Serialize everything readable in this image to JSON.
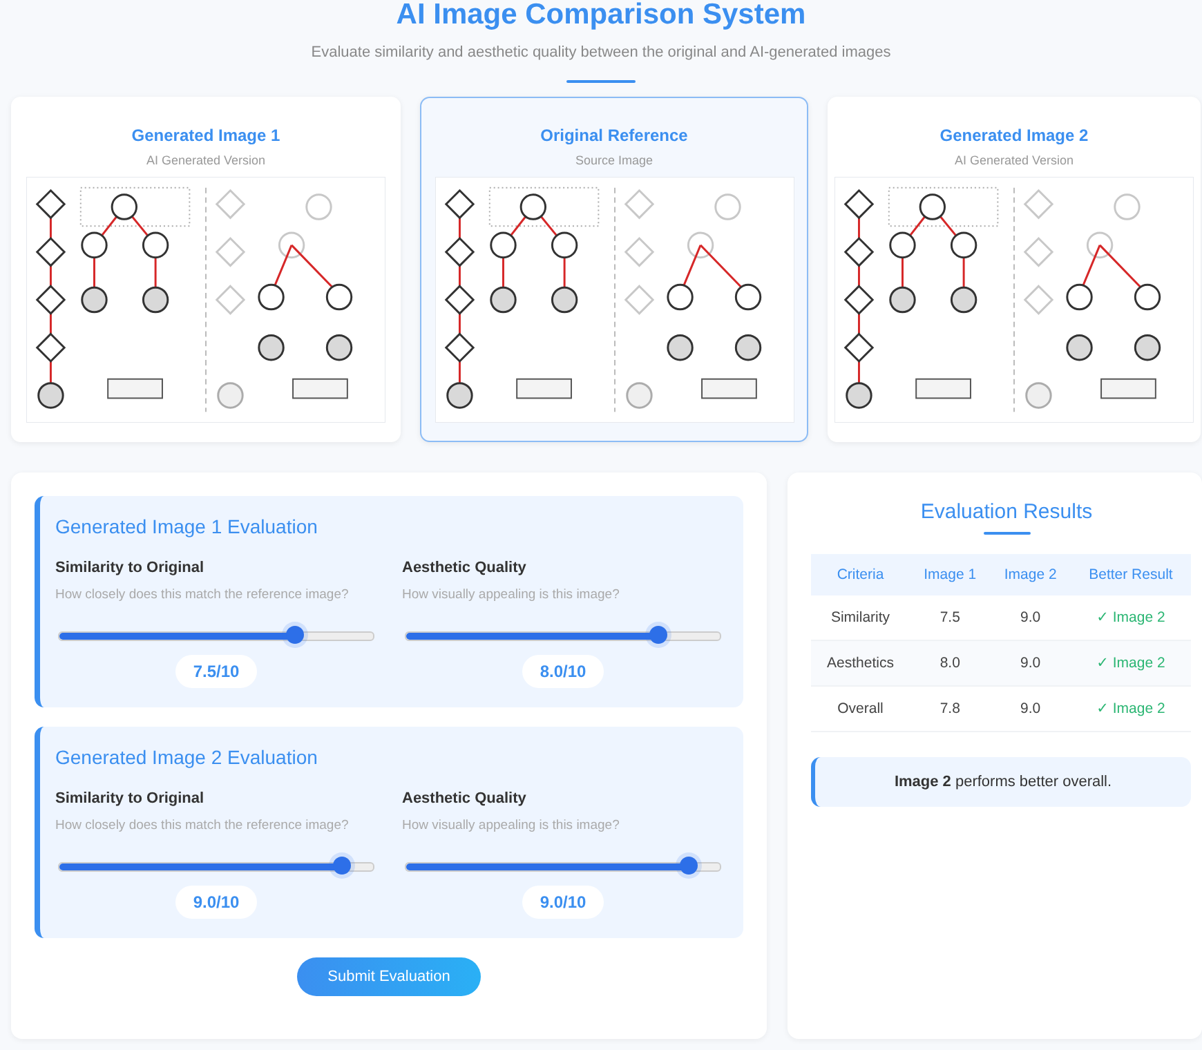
{
  "header": {
    "title": "AI Image Comparison System",
    "subtitle": "Evaluate similarity and aesthetic quality between the original and AI-generated images"
  },
  "images": [
    {
      "title": "Generated Image 1",
      "subtitle": "AI Generated Version",
      "selected": false,
      "kind": "picture"
    },
    {
      "title": "Original Reference",
      "subtitle": "Source Image",
      "selected": true,
      "kind": "picture"
    },
    {
      "title": "Generated Image 2",
      "subtitle": "AI Generated Version",
      "selected": false,
      "kind": "picture"
    }
  ],
  "evaluations": [
    {
      "title": "Generated Image 1 Evaluation",
      "criteria": [
        {
          "label": "Similarity to Original",
          "hint": "How closely does this match the reference image?",
          "level": 0.75,
          "reading": "7.5/10"
        },
        {
          "label": "Aesthetic Quality",
          "hint": "How visually appealing is this image?",
          "level": 0.8,
          "reading": "8.0/10"
        }
      ]
    },
    {
      "title": "Generated Image 2 Evaluation",
      "criteria": [
        {
          "label": "Similarity to Original",
          "hint": "How closely does this match the reference image?",
          "level": 0.9,
          "reading": "9.0/10"
        },
        {
          "label": "Aesthetic Quality",
          "hint": "How visually appealing is this image?",
          "level": 0.9,
          "reading": "9.0/10"
        }
      ]
    }
  ],
  "submit_button": "Submit Evaluation",
  "results": {
    "title": "Evaluation Results",
    "columns": [
      "Criteria",
      "Image 1",
      "Image 2",
      "Better Result"
    ],
    "rows": [
      {
        "criteria": "Similarity",
        "image_1": "7.5",
        "image_2": "9.0",
        "better": "✓ Image 2"
      },
      {
        "criteria": "Aesthetics",
        "image_1": "8.0",
        "image_2": "9.0",
        "better": "✓ Image 2"
      },
      {
        "criteria": "Overall",
        "image_1": "7.8",
        "image_2": "9.0",
        "better": "✓ Image 2"
      }
    ],
    "summary": "**Image 2** performs better overall."
  }
}
